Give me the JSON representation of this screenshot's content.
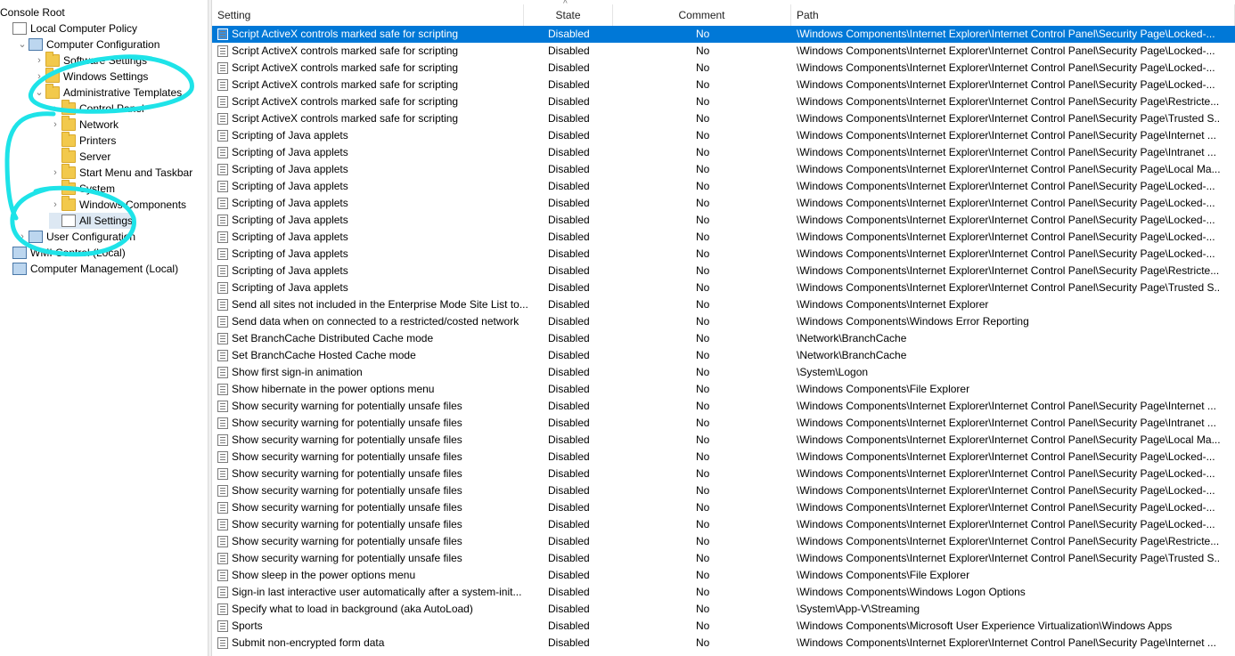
{
  "tree": {
    "items": [
      {
        "label": "Console Root",
        "indent": 0,
        "icon": "none",
        "chevron": ""
      },
      {
        "label": "Local Computer Policy",
        "indent": 0,
        "icon": "policy",
        "chevron": ""
      },
      {
        "label": "Computer Configuration",
        "indent": 1,
        "icon": "pc",
        "chevron": "expanded"
      },
      {
        "label": "Software Settings",
        "indent": 2,
        "icon": "folder",
        "chevron": "collapsed"
      },
      {
        "label": "Windows Settings",
        "indent": 2,
        "icon": "folder",
        "chevron": "collapsed"
      },
      {
        "label": "Administrative Templates",
        "indent": 2,
        "icon": "folder",
        "chevron": "expanded"
      },
      {
        "label": "Control Panel",
        "indent": 3,
        "icon": "folder",
        "chevron": "collapsed"
      },
      {
        "label": "Network",
        "indent": 3,
        "icon": "folder",
        "chevron": "collapsed"
      },
      {
        "label": "Printers",
        "indent": 3,
        "icon": "folder",
        "chevron": ""
      },
      {
        "label": "Server",
        "indent": 3,
        "icon": "folder",
        "chevron": ""
      },
      {
        "label": "Start Menu and Taskbar",
        "indent": 3,
        "icon": "folder",
        "chevron": "collapsed"
      },
      {
        "label": "System",
        "indent": 3,
        "icon": "folder",
        "chevron": "collapsed"
      },
      {
        "label": "Windows Components",
        "indent": 3,
        "icon": "folder",
        "chevron": "collapsed"
      },
      {
        "label": "All Settings",
        "indent": 3,
        "icon": "policy",
        "chevron": "",
        "selected": true
      },
      {
        "label": "User Configuration",
        "indent": 1,
        "icon": "pc",
        "chevron": "collapsed"
      },
      {
        "label": "WMI Control (Local)",
        "indent": 0,
        "icon": "pc",
        "chevron": ""
      },
      {
        "label": "Computer Management (Local)",
        "indent": 0,
        "icon": "pc",
        "chevron": ""
      }
    ]
  },
  "columns": {
    "setting": "Setting",
    "state": "State",
    "comment": "Comment",
    "path": "Path",
    "sort_indicator": "^"
  },
  "rows": [
    {
      "setting": "Script ActiveX controls marked safe for scripting",
      "state": "Disabled",
      "comment": "No",
      "path": "\\Windows Components\\Internet Explorer\\Internet Control Panel\\Security Page\\Locked-...",
      "selected": true
    },
    {
      "setting": "Script ActiveX controls marked safe for scripting",
      "state": "Disabled",
      "comment": "No",
      "path": "\\Windows Components\\Internet Explorer\\Internet Control Panel\\Security Page\\Locked-..."
    },
    {
      "setting": "Script ActiveX controls marked safe for scripting",
      "state": "Disabled",
      "comment": "No",
      "path": "\\Windows Components\\Internet Explorer\\Internet Control Panel\\Security Page\\Locked-..."
    },
    {
      "setting": "Script ActiveX controls marked safe for scripting",
      "state": "Disabled",
      "comment": "No",
      "path": "\\Windows Components\\Internet Explorer\\Internet Control Panel\\Security Page\\Locked-..."
    },
    {
      "setting": "Script ActiveX controls marked safe for scripting",
      "state": "Disabled",
      "comment": "No",
      "path": "\\Windows Components\\Internet Explorer\\Internet Control Panel\\Security Page\\Restricte..."
    },
    {
      "setting": "Script ActiveX controls marked safe for scripting",
      "state": "Disabled",
      "comment": "No",
      "path": "\\Windows Components\\Internet Explorer\\Internet Control Panel\\Security Page\\Trusted S..."
    },
    {
      "setting": "Scripting of Java applets",
      "state": "Disabled",
      "comment": "No",
      "path": "\\Windows Components\\Internet Explorer\\Internet Control Panel\\Security Page\\Internet ..."
    },
    {
      "setting": "Scripting of Java applets",
      "state": "Disabled",
      "comment": "No",
      "path": "\\Windows Components\\Internet Explorer\\Internet Control Panel\\Security Page\\Intranet ..."
    },
    {
      "setting": "Scripting of Java applets",
      "state": "Disabled",
      "comment": "No",
      "path": "\\Windows Components\\Internet Explorer\\Internet Control Panel\\Security Page\\Local Ma..."
    },
    {
      "setting": "Scripting of Java applets",
      "state": "Disabled",
      "comment": "No",
      "path": "\\Windows Components\\Internet Explorer\\Internet Control Panel\\Security Page\\Locked-..."
    },
    {
      "setting": "Scripting of Java applets",
      "state": "Disabled",
      "comment": "No",
      "path": "\\Windows Components\\Internet Explorer\\Internet Control Panel\\Security Page\\Locked-..."
    },
    {
      "setting": "Scripting of Java applets",
      "state": "Disabled",
      "comment": "No",
      "path": "\\Windows Components\\Internet Explorer\\Internet Control Panel\\Security Page\\Locked-..."
    },
    {
      "setting": "Scripting of Java applets",
      "state": "Disabled",
      "comment": "No",
      "path": "\\Windows Components\\Internet Explorer\\Internet Control Panel\\Security Page\\Locked-..."
    },
    {
      "setting": "Scripting of Java applets",
      "state": "Disabled",
      "comment": "No",
      "path": "\\Windows Components\\Internet Explorer\\Internet Control Panel\\Security Page\\Locked-..."
    },
    {
      "setting": "Scripting of Java applets",
      "state": "Disabled",
      "comment": "No",
      "path": "\\Windows Components\\Internet Explorer\\Internet Control Panel\\Security Page\\Restricte..."
    },
    {
      "setting": "Scripting of Java applets",
      "state": "Disabled",
      "comment": "No",
      "path": "\\Windows Components\\Internet Explorer\\Internet Control Panel\\Security Page\\Trusted S..."
    },
    {
      "setting": "Send all sites not included in the Enterprise Mode Site List to...",
      "state": "Disabled",
      "comment": "No",
      "path": "\\Windows Components\\Internet Explorer"
    },
    {
      "setting": "Send data when on connected to a restricted/costed network",
      "state": "Disabled",
      "comment": "No",
      "path": "\\Windows Components\\Windows Error Reporting"
    },
    {
      "setting": "Set BranchCache Distributed Cache mode",
      "state": "Disabled",
      "comment": "No",
      "path": "\\Network\\BranchCache"
    },
    {
      "setting": "Set BranchCache Hosted Cache mode",
      "state": "Disabled",
      "comment": "No",
      "path": "\\Network\\BranchCache"
    },
    {
      "setting": "Show first sign-in animation",
      "state": "Disabled",
      "comment": "No",
      "path": "\\System\\Logon"
    },
    {
      "setting": "Show hibernate in the power options menu",
      "state": "Disabled",
      "comment": "No",
      "path": "\\Windows Components\\File Explorer"
    },
    {
      "setting": "Show security warning for potentially unsafe files",
      "state": "Disabled",
      "comment": "No",
      "path": "\\Windows Components\\Internet Explorer\\Internet Control Panel\\Security Page\\Internet ..."
    },
    {
      "setting": "Show security warning for potentially unsafe files",
      "state": "Disabled",
      "comment": "No",
      "path": "\\Windows Components\\Internet Explorer\\Internet Control Panel\\Security Page\\Intranet ..."
    },
    {
      "setting": "Show security warning for potentially unsafe files",
      "state": "Disabled",
      "comment": "No",
      "path": "\\Windows Components\\Internet Explorer\\Internet Control Panel\\Security Page\\Local Ma..."
    },
    {
      "setting": "Show security warning for potentially unsafe files",
      "state": "Disabled",
      "comment": "No",
      "path": "\\Windows Components\\Internet Explorer\\Internet Control Panel\\Security Page\\Locked-..."
    },
    {
      "setting": "Show security warning for potentially unsafe files",
      "state": "Disabled",
      "comment": "No",
      "path": "\\Windows Components\\Internet Explorer\\Internet Control Panel\\Security Page\\Locked-..."
    },
    {
      "setting": "Show security warning for potentially unsafe files",
      "state": "Disabled",
      "comment": "No",
      "path": "\\Windows Components\\Internet Explorer\\Internet Control Panel\\Security Page\\Locked-..."
    },
    {
      "setting": "Show security warning for potentially unsafe files",
      "state": "Disabled",
      "comment": "No",
      "path": "\\Windows Components\\Internet Explorer\\Internet Control Panel\\Security Page\\Locked-..."
    },
    {
      "setting": "Show security warning for potentially unsafe files",
      "state": "Disabled",
      "comment": "No",
      "path": "\\Windows Components\\Internet Explorer\\Internet Control Panel\\Security Page\\Locked-..."
    },
    {
      "setting": "Show security warning for potentially unsafe files",
      "state": "Disabled",
      "comment": "No",
      "path": "\\Windows Components\\Internet Explorer\\Internet Control Panel\\Security Page\\Restricte..."
    },
    {
      "setting": "Show security warning for potentially unsafe files",
      "state": "Disabled",
      "comment": "No",
      "path": "\\Windows Components\\Internet Explorer\\Internet Control Panel\\Security Page\\Trusted S..."
    },
    {
      "setting": "Show sleep in the power options menu",
      "state": "Disabled",
      "comment": "No",
      "path": "\\Windows Components\\File Explorer"
    },
    {
      "setting": "Sign-in last interactive user automatically after a system-init...",
      "state": "Disabled",
      "comment": "No",
      "path": "\\Windows Components\\Windows Logon Options"
    },
    {
      "setting": "Specify what to load in background (aka AutoLoad)",
      "state": "Disabled",
      "comment": "No",
      "path": "\\System\\App-V\\Streaming"
    },
    {
      "setting": "Sports",
      "state": "Disabled",
      "comment": "No",
      "path": "\\Windows Components\\Microsoft User Experience Virtualization\\Windows Apps"
    },
    {
      "setting": "Submit non-encrypted form data",
      "state": "Disabled",
      "comment": "No",
      "path": "\\Windows Components\\Internet Explorer\\Internet Control Panel\\Security Page\\Internet ..."
    }
  ],
  "annotation_color": "#1ee3e8",
  "selection_color": "#0078d7"
}
